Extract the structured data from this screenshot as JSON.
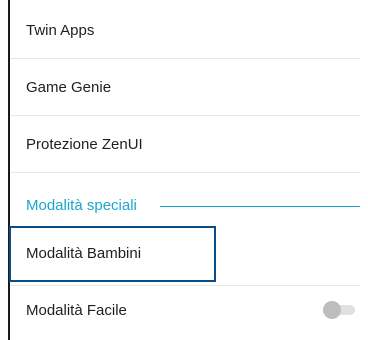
{
  "settings": {
    "items": [
      {
        "label": "Twin Apps"
      },
      {
        "label": "Game Genie"
      },
      {
        "label": "Protezione ZenUI"
      }
    ],
    "section_header": "Modalità speciali",
    "special_items": [
      {
        "label": "Modalità Bambini",
        "highlighted": true
      },
      {
        "label": "Modalità Facile",
        "toggle_on": false
      }
    ]
  },
  "colors": {
    "accent": "#19a7cf",
    "highlight_border": "#0b4a8b",
    "toggle_off_thumb": "#bdbdbd",
    "toggle_off_track": "#e0e0e0"
  }
}
